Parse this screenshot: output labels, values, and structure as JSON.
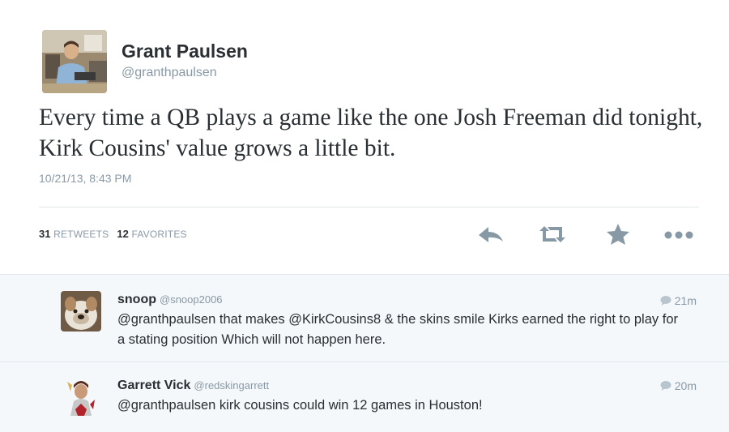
{
  "tweet": {
    "author_name": "Grant Paulsen",
    "author_handle": "@granthpaulsen",
    "text": "Every time a QB plays a game like the one Josh Freeman did tonight, Kirk Cousins' value grows a little bit.",
    "timestamp": "10/21/13, 8:43 PM",
    "retweets_count": "31",
    "retweets_label": "RETWEETS",
    "favorites_count": "12",
    "favorites_label": "FAVORITES"
  },
  "actions": {
    "icons": [
      "reply-icon",
      "retweet-icon",
      "favorite-star-icon",
      "more-options-icon"
    ]
  },
  "replies": [
    {
      "name": "snoop",
      "handle": "@snoop2006",
      "time": "21m",
      "text": "@granthpaulsen that makes @KirkCousins8 & the skins smile Kirks earned the right to play for a stating position Which will not happen here."
    },
    {
      "name": "Garrett Vick",
      "handle": "@redskingarrett",
      "time": "20m",
      "text": "@granthpaulsen kirk cousins could win 12 games in Houston!"
    }
  ],
  "colors": {
    "text_primary": "#292f33",
    "text_secondary": "#8899a6",
    "action_icon": "#8899a6",
    "reply_background": "#f5f8fa",
    "divider": "#e1e8ed"
  }
}
